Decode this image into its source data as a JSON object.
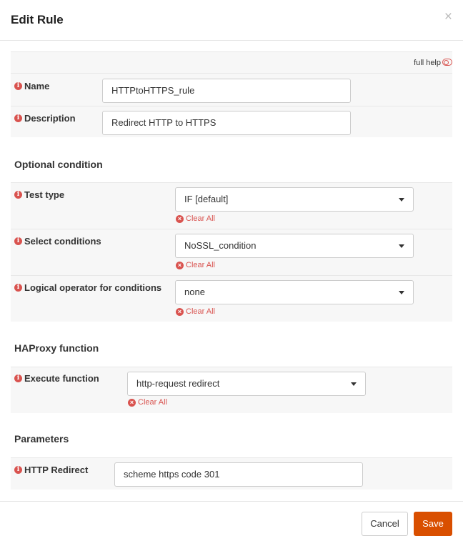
{
  "modal": {
    "title": "Edit Rule",
    "close_label": "×"
  },
  "help": {
    "label": "full help"
  },
  "fields": {
    "name": {
      "label": "Name",
      "value": "HTTPtoHTTPS_rule"
    },
    "description": {
      "label": "Description",
      "value": "Redirect HTTP to HTTPS"
    }
  },
  "sections": {
    "optional_condition": "Optional condition",
    "haproxy_function": "HAProxy function",
    "parameters": "Parameters"
  },
  "conditions": {
    "test_type": {
      "label": "Test type",
      "value": "IF [default]",
      "clear": "Clear All"
    },
    "select_conditions": {
      "label": "Select conditions",
      "value": "NoSSL_condition",
      "clear": "Clear All"
    },
    "logical_operator": {
      "label": "Logical operator for conditions",
      "value": "none",
      "clear": "Clear All"
    }
  },
  "function": {
    "execute": {
      "label": "Execute function",
      "value": "http-request redirect",
      "clear": "Clear All"
    }
  },
  "parameters": {
    "http_redirect": {
      "label": "HTTP Redirect",
      "value": "scheme https code 301"
    }
  },
  "footer": {
    "cancel_label": "Cancel",
    "save_label": "Save"
  },
  "colors": {
    "accent": "#d94f00",
    "danger": "#d9534f",
    "row_bg": "#f7f7f7"
  }
}
